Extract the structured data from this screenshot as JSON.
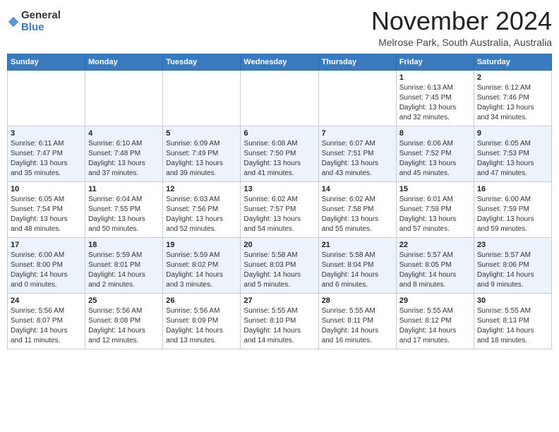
{
  "header": {
    "logo_general": "General",
    "logo_blue": "Blue",
    "month": "November 2024",
    "location": "Melrose Park, South Australia, Australia"
  },
  "weekdays": [
    "Sunday",
    "Monday",
    "Tuesday",
    "Wednesday",
    "Thursday",
    "Friday",
    "Saturday"
  ],
  "rows": [
    [
      {
        "num": "",
        "info": ""
      },
      {
        "num": "",
        "info": ""
      },
      {
        "num": "",
        "info": ""
      },
      {
        "num": "",
        "info": ""
      },
      {
        "num": "",
        "info": ""
      },
      {
        "num": "1",
        "info": "Sunrise: 6:13 AM\nSunset: 7:45 PM\nDaylight: 13 hours\nand 32 minutes."
      },
      {
        "num": "2",
        "info": "Sunrise: 6:12 AM\nSunset: 7:46 PM\nDaylight: 13 hours\nand 34 minutes."
      }
    ],
    [
      {
        "num": "3",
        "info": "Sunrise: 6:11 AM\nSunset: 7:47 PM\nDaylight: 13 hours\nand 35 minutes."
      },
      {
        "num": "4",
        "info": "Sunrise: 6:10 AM\nSunset: 7:48 PM\nDaylight: 13 hours\nand 37 minutes."
      },
      {
        "num": "5",
        "info": "Sunrise: 6:09 AM\nSunset: 7:49 PM\nDaylight: 13 hours\nand 39 minutes."
      },
      {
        "num": "6",
        "info": "Sunrise: 6:08 AM\nSunset: 7:50 PM\nDaylight: 13 hours\nand 41 minutes."
      },
      {
        "num": "7",
        "info": "Sunrise: 6:07 AM\nSunset: 7:51 PM\nDaylight: 13 hours\nand 43 minutes."
      },
      {
        "num": "8",
        "info": "Sunrise: 6:06 AM\nSunset: 7:52 PM\nDaylight: 13 hours\nand 45 minutes."
      },
      {
        "num": "9",
        "info": "Sunrise: 6:05 AM\nSunset: 7:53 PM\nDaylight: 13 hours\nand 47 minutes."
      }
    ],
    [
      {
        "num": "10",
        "info": "Sunrise: 6:05 AM\nSunset: 7:54 PM\nDaylight: 13 hours\nand 48 minutes."
      },
      {
        "num": "11",
        "info": "Sunrise: 6:04 AM\nSunset: 7:55 PM\nDaylight: 13 hours\nand 50 minutes."
      },
      {
        "num": "12",
        "info": "Sunrise: 6:03 AM\nSunset: 7:56 PM\nDaylight: 13 hours\nand 52 minutes."
      },
      {
        "num": "13",
        "info": "Sunrise: 6:02 AM\nSunset: 7:57 PM\nDaylight: 13 hours\nand 54 minutes."
      },
      {
        "num": "14",
        "info": "Sunrise: 6:02 AM\nSunset: 7:58 PM\nDaylight: 13 hours\nand 55 minutes."
      },
      {
        "num": "15",
        "info": "Sunrise: 6:01 AM\nSunset: 7:59 PM\nDaylight: 13 hours\nand 57 minutes."
      },
      {
        "num": "16",
        "info": "Sunrise: 6:00 AM\nSunset: 7:59 PM\nDaylight: 13 hours\nand 59 minutes."
      }
    ],
    [
      {
        "num": "17",
        "info": "Sunrise: 6:00 AM\nSunset: 8:00 PM\nDaylight: 14 hours\nand 0 minutes."
      },
      {
        "num": "18",
        "info": "Sunrise: 5:59 AM\nSunset: 8:01 PM\nDaylight: 14 hours\nand 2 minutes."
      },
      {
        "num": "19",
        "info": "Sunrise: 5:59 AM\nSunset: 8:02 PM\nDaylight: 14 hours\nand 3 minutes."
      },
      {
        "num": "20",
        "info": "Sunrise: 5:58 AM\nSunset: 8:03 PM\nDaylight: 14 hours\nand 5 minutes."
      },
      {
        "num": "21",
        "info": "Sunrise: 5:58 AM\nSunset: 8:04 PM\nDaylight: 14 hours\nand 6 minutes."
      },
      {
        "num": "22",
        "info": "Sunrise: 5:57 AM\nSunset: 8:05 PM\nDaylight: 14 hours\nand 8 minutes."
      },
      {
        "num": "23",
        "info": "Sunrise: 5:57 AM\nSunset: 8:06 PM\nDaylight: 14 hours\nand 9 minutes."
      }
    ],
    [
      {
        "num": "24",
        "info": "Sunrise: 5:56 AM\nSunset: 8:07 PM\nDaylight: 14 hours\nand 11 minutes."
      },
      {
        "num": "25",
        "info": "Sunrise: 5:56 AM\nSunset: 8:08 PM\nDaylight: 14 hours\nand 12 minutes."
      },
      {
        "num": "26",
        "info": "Sunrise: 5:56 AM\nSunset: 8:09 PM\nDaylight: 14 hours\nand 13 minutes."
      },
      {
        "num": "27",
        "info": "Sunrise: 5:55 AM\nSunset: 8:10 PM\nDaylight: 14 hours\nand 14 minutes."
      },
      {
        "num": "28",
        "info": "Sunrise: 5:55 AM\nSunset: 8:11 PM\nDaylight: 14 hours\nand 16 minutes."
      },
      {
        "num": "29",
        "info": "Sunrise: 5:55 AM\nSunset: 8:12 PM\nDaylight: 14 hours\nand 17 minutes."
      },
      {
        "num": "30",
        "info": "Sunrise: 5:55 AM\nSunset: 8:13 PM\nDaylight: 14 hours\nand 18 minutes."
      }
    ]
  ]
}
